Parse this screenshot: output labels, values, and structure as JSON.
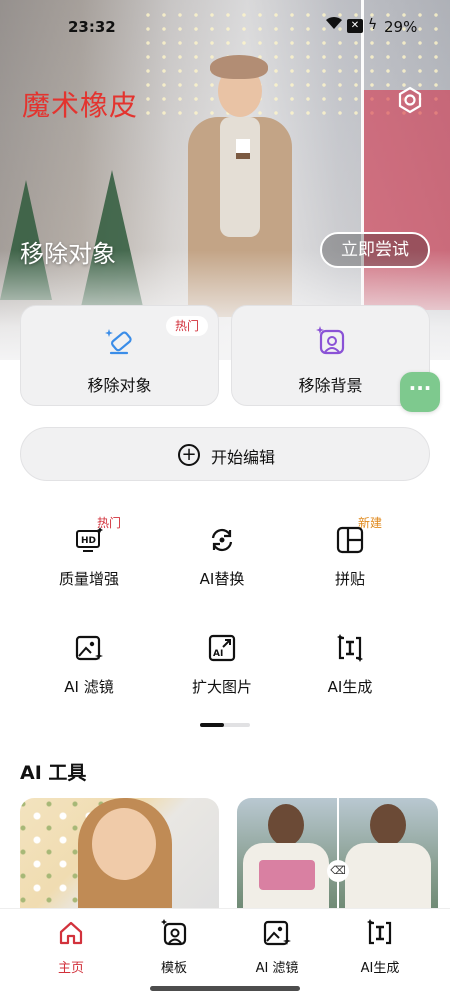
{
  "status_bar": {
    "time": "23:32",
    "battery": "29%"
  },
  "hero": {
    "brand": "魔术橡皮",
    "title": "移除对象",
    "cta": "立即尝试"
  },
  "cards": [
    {
      "label": "移除对象",
      "badge": "热门",
      "icon": "eraser-sparkle-icon"
    },
    {
      "label": "移除背景",
      "icon": "portrait-sparkle-icon"
    }
  ],
  "edit_button": {
    "label": "开始编辑"
  },
  "grid": [
    {
      "label": "质量增强",
      "tag": "热门",
      "icon": "hd-icon"
    },
    {
      "label": "AI替换",
      "icon": "replace-icon"
    },
    {
      "label": "拼贴",
      "tag": "新建",
      "icon": "collage-icon"
    },
    {
      "label": "AI 滤镜",
      "icon": "filter-icon"
    },
    {
      "label": "扩大图片",
      "icon": "expand-icon"
    },
    {
      "label": "AI生成",
      "icon": "generate-icon"
    }
  ],
  "section": {
    "title": "AI 工具"
  },
  "nav": [
    {
      "label": "主页",
      "icon": "home-icon",
      "active": true
    },
    {
      "label": "模板",
      "icon": "template-icon"
    },
    {
      "label": "AI 滤镜",
      "icon": "filter-icon"
    },
    {
      "label": "AI生成",
      "icon": "generate-icon"
    }
  ],
  "colors": {
    "accent": "#d2323c",
    "brand_red": "#e3342f",
    "float_green": "#7ec98e",
    "new_tag": "#e08a1e"
  }
}
